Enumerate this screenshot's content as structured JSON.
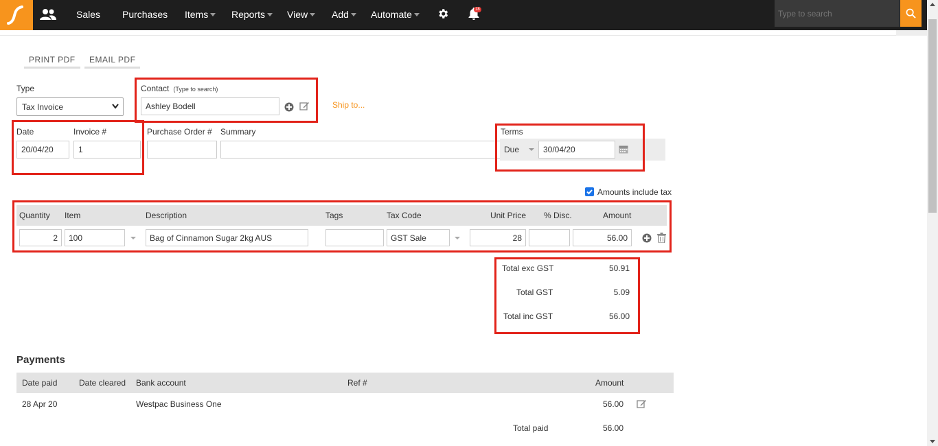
{
  "nav": {
    "items": [
      {
        "label": "Sales"
      },
      {
        "label": "Purchases"
      },
      {
        "label": "Items"
      },
      {
        "label": "Reports"
      },
      {
        "label": "View"
      },
      {
        "label": "Add"
      },
      {
        "label": "Automate"
      }
    ],
    "notification_count": "18",
    "search_placeholder": "Type to search",
    "accent_color": "#f7941d"
  },
  "toolbar": {
    "print_pdf": "PRINT PDF",
    "email_pdf": "EMAIL PDF"
  },
  "form": {
    "type_label": "Type",
    "type_value": "Tax Invoice",
    "contact_label": "Contact",
    "contact_hint": "(Type to search)",
    "contact_value": "Ashley Bodell",
    "ship_to": "Ship to...",
    "date_label": "Date",
    "date_value": "20/04/20",
    "invoice_label": "Invoice #",
    "invoice_value": "1",
    "po_label": "Purchase Order #",
    "po_value": "",
    "summary_label": "Summary",
    "summary_value": "",
    "terms_label": "Terms",
    "terms_type": "Due",
    "terms_date": "30/04/20",
    "amounts_include_tax": "Amounts include tax"
  },
  "lines": {
    "headers": {
      "quantity": "Quantity",
      "item": "Item",
      "description": "Description",
      "tags": "Tags",
      "tax_code": "Tax Code",
      "unit_price": "Unit Price",
      "disc": "% Disc.",
      "amount": "Amount"
    },
    "row": {
      "quantity": "2",
      "item": "100",
      "description": "Bag of Cinnamon Sugar 2kg AUS",
      "tags": "",
      "tax_code": "GST Sale",
      "unit_price": "28",
      "disc": "",
      "amount": "56.00"
    }
  },
  "totals": {
    "exc_label": "Total exc GST",
    "exc_value": "50.91",
    "gst_label": "Total GST",
    "gst_value": "5.09",
    "inc_label": "Total inc GST",
    "inc_value": "56.00"
  },
  "payments": {
    "title": "Payments",
    "headers": {
      "date_paid": "Date paid",
      "date_cleared": "Date cleared",
      "bank_account": "Bank account",
      "ref": "Ref #",
      "amount": "Amount"
    },
    "row": {
      "date_paid": "28 Apr 20",
      "date_cleared": "",
      "bank_account": "Westpac Business One",
      "ref": "",
      "amount": "56.00"
    },
    "total_paid_label": "Total paid",
    "total_paid_value": "56.00"
  },
  "highlight_color": "#e2231a"
}
